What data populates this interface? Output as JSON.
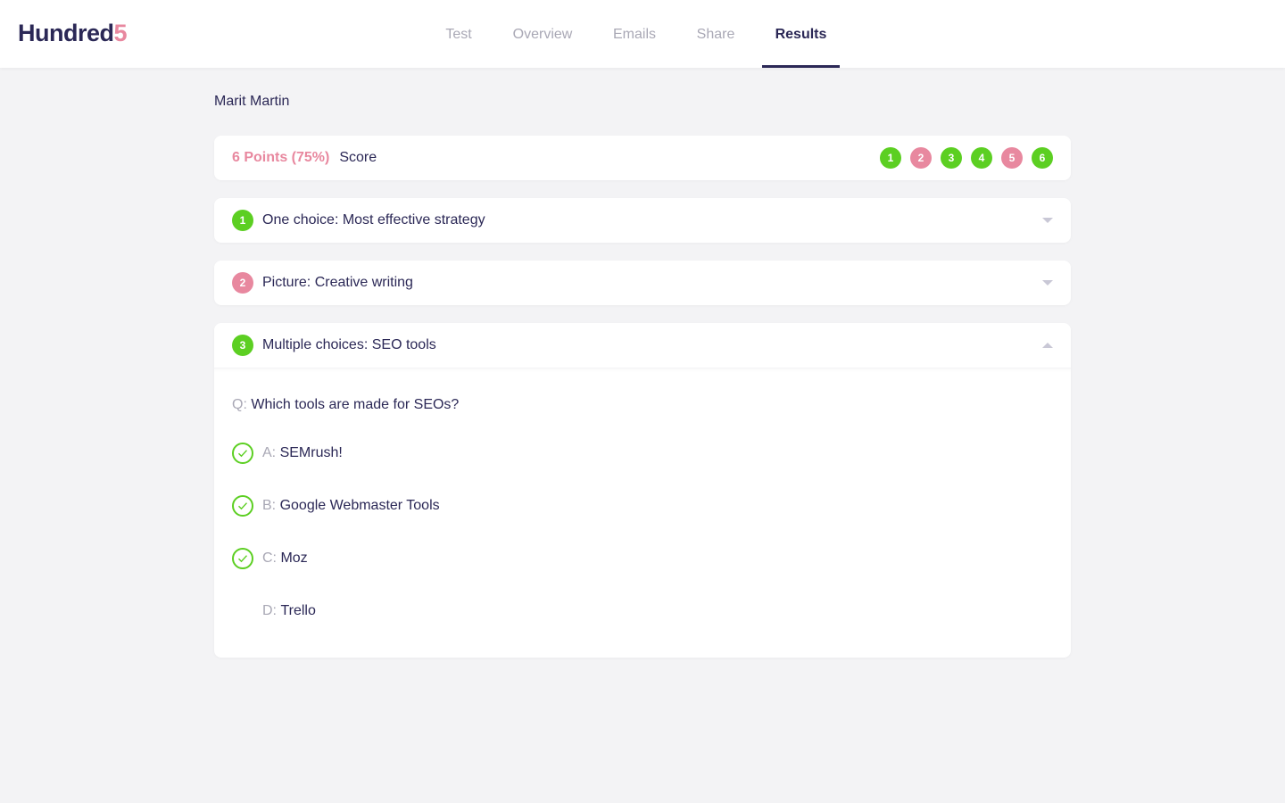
{
  "logo": {
    "main": "Hundred",
    "accent": "5"
  },
  "nav": [
    {
      "label": "Test"
    },
    {
      "label": "Overview"
    },
    {
      "label": "Emails"
    },
    {
      "label": "Share"
    },
    {
      "label": "Results"
    }
  ],
  "candidate": "Marit Martin",
  "score": {
    "points": "6 Points (75%)",
    "label": "Score",
    "questions": [
      {
        "n": "1",
        "correct": true
      },
      {
        "n": "2",
        "correct": false
      },
      {
        "n": "3",
        "correct": true
      },
      {
        "n": "4",
        "correct": true
      },
      {
        "n": "5",
        "correct": false
      },
      {
        "n": "6",
        "correct": true
      }
    ]
  },
  "questions": [
    {
      "n": "1",
      "title": "One choice: Most effective strategy",
      "correct": true,
      "expanded": false
    },
    {
      "n": "2",
      "title": "Picture: Creative writing",
      "correct": false,
      "expanded": false
    },
    {
      "n": "3",
      "title": "Multiple choices: SEO tools",
      "correct": true,
      "expanded": true,
      "q_label": "Q:",
      "question": "Which tools are made for SEOs?",
      "answers": [
        {
          "label": "A:",
          "text": "SEMrush!",
          "checked": true
        },
        {
          "label": "B:",
          "text": "Google Webmaster Tools",
          "checked": true
        },
        {
          "label": "C:",
          "text": "Moz",
          "checked": true
        },
        {
          "label": "D:",
          "text": "Trello",
          "checked": false
        }
      ]
    }
  ],
  "colors": {
    "correct": "#5ccf22",
    "wrong": "#e8889f",
    "text": "#2b2856"
  }
}
